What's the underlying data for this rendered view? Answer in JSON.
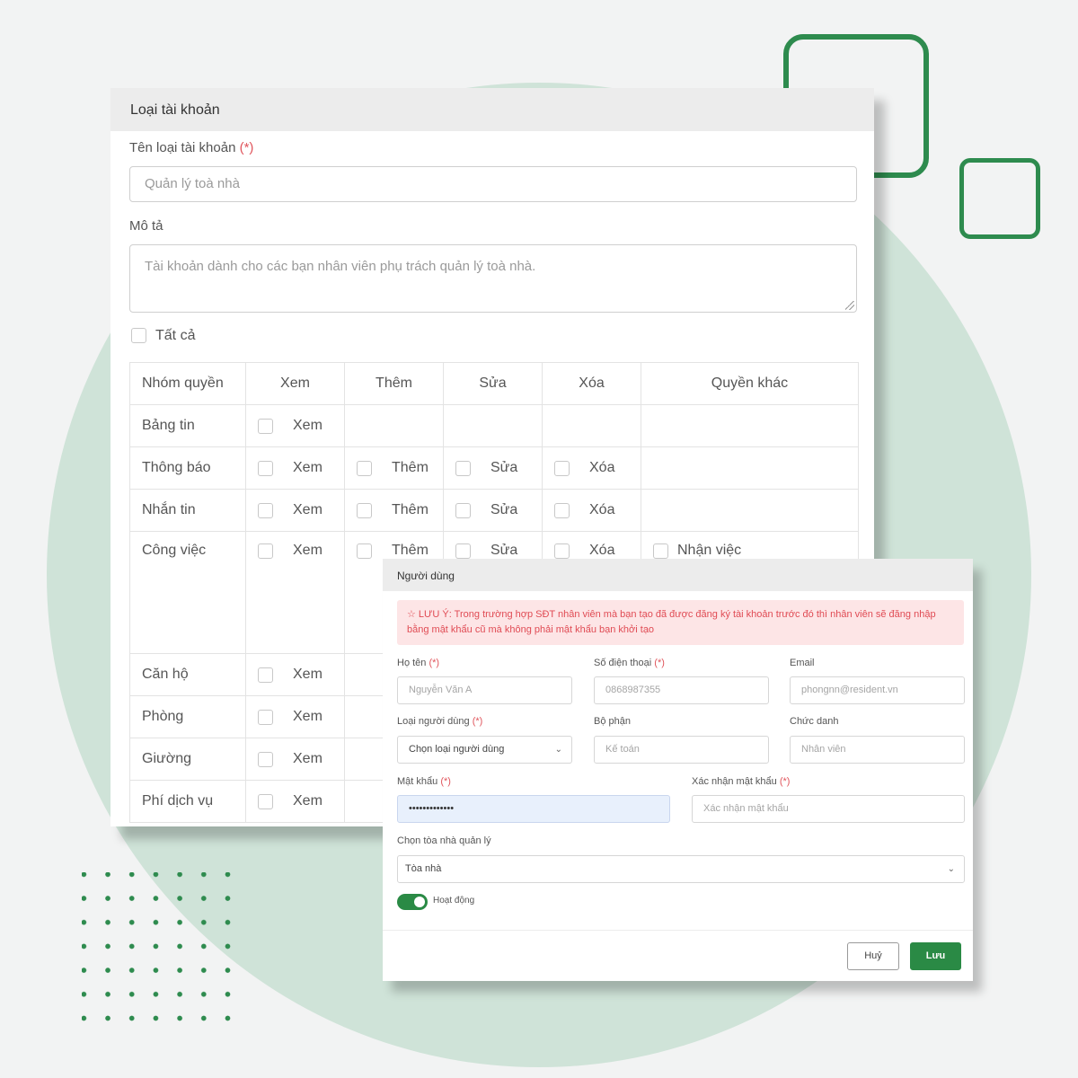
{
  "account_type_panel": {
    "title": "Loại tài khoản",
    "name_label": "Tên loại tài khoản",
    "required_mark": "(*)",
    "name_value": "Quản lý toà nhà",
    "description_label": "Mô tả",
    "description_value": "Tài khoản dành cho các bạn nhân viên phụ trách quản lý toà nhà.",
    "select_all_label": "Tất cả",
    "table": {
      "headers": [
        "Nhóm quyền",
        "Xem",
        "Thêm",
        "Sửa",
        "Xóa",
        "Quyền khác"
      ],
      "rows": [
        {
          "group": "Bảng tin",
          "view": "Xem",
          "add": "",
          "edit": "",
          "delete": "",
          "other": ""
        },
        {
          "group": "Thông báo",
          "view": "Xem",
          "add": "Thêm",
          "edit": "Sửa",
          "delete": "Xóa",
          "other": ""
        },
        {
          "group": "Nhắn tin",
          "view": "Xem",
          "add": "Thêm",
          "edit": "Sửa",
          "delete": "Xóa",
          "other": ""
        },
        {
          "group": "Công việc",
          "view": "Xem",
          "add": "Thêm",
          "edit": "Sửa",
          "delete": "Xóa",
          "other": "Nhận việc"
        },
        {
          "group": "Căn hộ",
          "view": "Xem",
          "add": "",
          "edit": "",
          "delete": "",
          "other": ""
        },
        {
          "group": "Phòng",
          "view": "Xem",
          "add": "",
          "edit": "",
          "delete": "",
          "other": ""
        },
        {
          "group": "Giường",
          "view": "Xem",
          "add": "",
          "edit": "",
          "delete": "",
          "other": ""
        },
        {
          "group": "Phí dịch vụ",
          "view": "Xem",
          "add": "",
          "edit": "",
          "delete": "",
          "other": ""
        }
      ]
    }
  },
  "user_panel": {
    "title": "Người dùng",
    "alert": "☆ LƯU Ý: Trong trường hợp SĐT nhân viên mà bạn tạo đã được đăng ký tài khoản trước đó thì nhân viên sẽ đăng nhập bằng mật khẩu cũ mà không phải mật khẩu bạn khởi tạo",
    "full_name_label": "Họ tên",
    "full_name_placeholder": "Nguyễn Văn A",
    "phone_label": "Số điện thoại",
    "phone_placeholder": "0868987355",
    "email_label": "Email",
    "email_placeholder": "phongnn@resident.vn",
    "user_type_label": "Loại người dùng",
    "user_type_value": "Chọn loại người dùng",
    "department_label": "Bộ phận",
    "department_placeholder": "Kế toán",
    "position_label": "Chức danh",
    "position_placeholder": "Nhân viên",
    "password_label": "Mật khẩu",
    "password_value": "•••••••••••••",
    "confirm_password_label": "Xác nhận mật khẩu",
    "confirm_password_placeholder": "Xác nhận mật khẩu",
    "building_label": "Chọn tòa nhà quản lý",
    "building_value": "Tòa nhà",
    "active_label": "Hoạt động",
    "active": true,
    "required_mark": "(*)",
    "cancel_label": "Huỷ",
    "save_label": "Lưu"
  },
  "colors": {
    "brand_green": "#2e8b4e",
    "circle_bg": "#cfe3d8",
    "alert_text": "#e04b54"
  },
  "icons": {
    "chevron": "chevron-down-icon",
    "star": "star-outline-icon"
  }
}
